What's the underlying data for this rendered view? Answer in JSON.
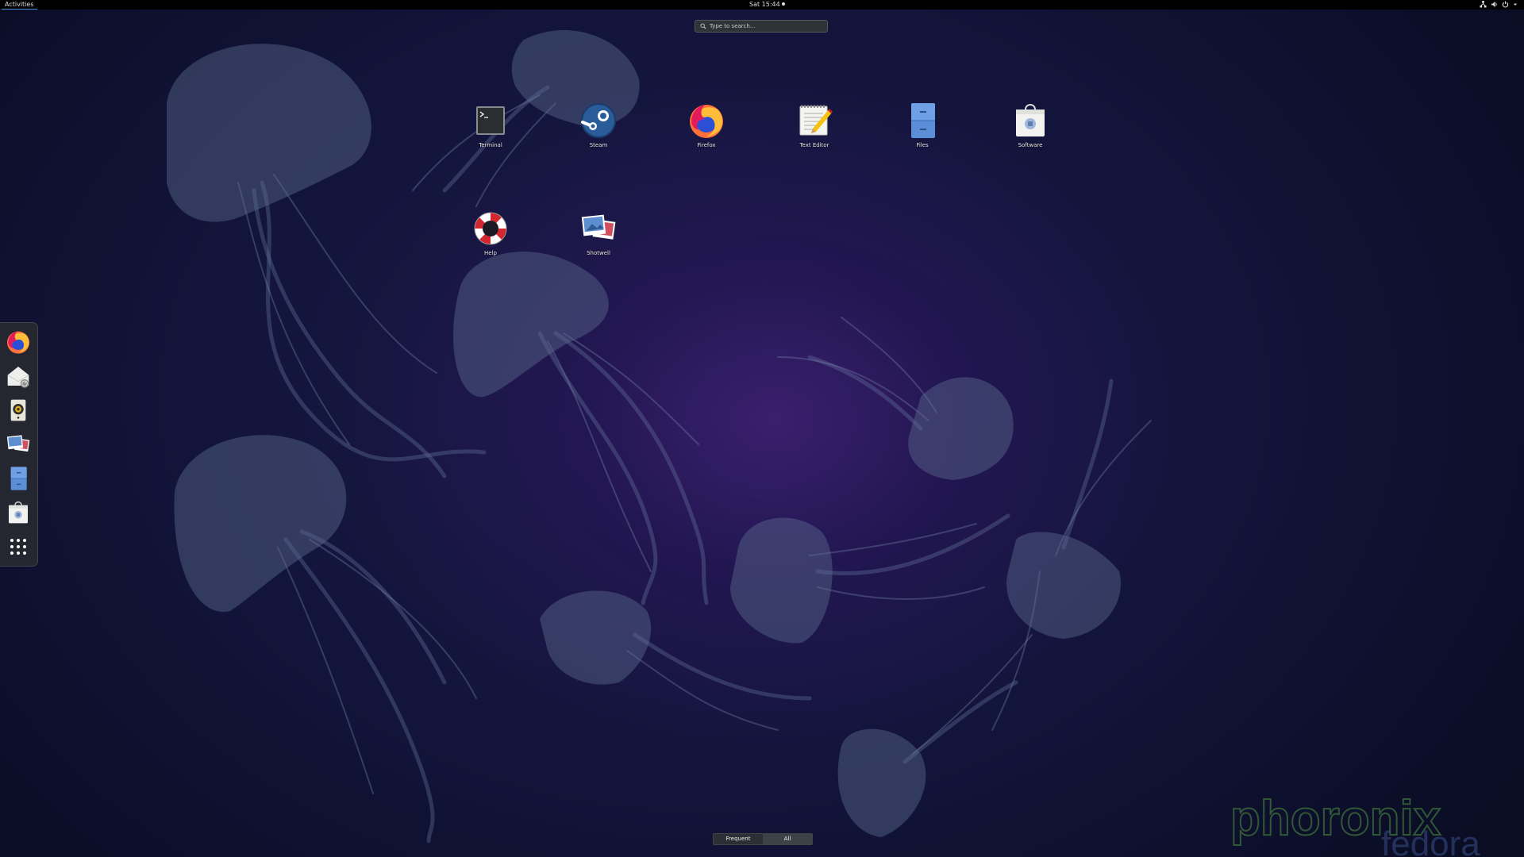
{
  "top_bar": {
    "activities_label": "Activities",
    "clock": "Sat 15:44",
    "status_icons": [
      "network-icon",
      "volume-icon",
      "power-icon",
      "arrow-down-icon"
    ]
  },
  "search": {
    "placeholder": "Type to search…"
  },
  "app_grid": [
    {
      "name": "terminal",
      "label": "Terminal",
      "icon": "terminal-icon"
    },
    {
      "name": "steam",
      "label": "Steam",
      "icon": "steam-icon"
    },
    {
      "name": "firefox",
      "label": "Firefox",
      "icon": "firefox-icon"
    },
    {
      "name": "text-editor",
      "label": "Text Editor",
      "icon": "text-editor-icon"
    },
    {
      "name": "files",
      "label": "Files",
      "icon": "files-icon"
    },
    {
      "name": "software",
      "label": "Software",
      "icon": "software-icon"
    },
    {
      "name": "help",
      "label": "Help",
      "icon": "help-icon"
    },
    {
      "name": "shotwell",
      "label": "Shotwell",
      "icon": "shotwell-icon"
    }
  ],
  "dash": [
    "firefox-icon",
    "evolution-icon",
    "rhythmbox-icon",
    "shotwell-icon",
    "files-icon",
    "software-icon",
    "show-applications-icon"
  ],
  "view_selector": {
    "frequent_label": "Frequent",
    "all_label": "All",
    "active": "All"
  },
  "watermark": {
    "text": "phoronix",
    "subtext": "fedora"
  },
  "colors": {
    "top_bar": "#000000",
    "accent": "#4a90d9",
    "background": "#12143a"
  }
}
